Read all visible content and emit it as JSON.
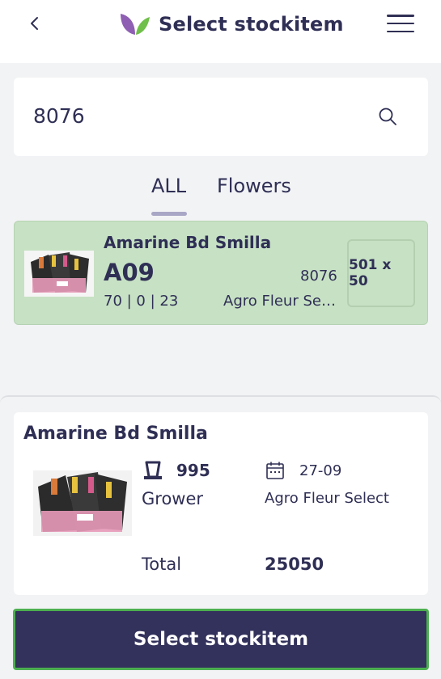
{
  "header": {
    "back_icon": "chevron-left-icon",
    "title": "Select stockitem",
    "menu_icon": "hamburger-menu-icon",
    "logo_colors": [
      "#8e5fb3",
      "#6fbf4a"
    ]
  },
  "search": {
    "value": "8076",
    "icon": "search-icon"
  },
  "tabs": [
    {
      "label": "ALL",
      "active": true
    },
    {
      "label": "Flowers",
      "active": false
    }
  ],
  "result": {
    "name": "Amarine Bd Smilla",
    "code": "A09",
    "number": "8076",
    "stock": "70 | 0 | 23",
    "supplier": "Agro Fleur Sel...",
    "size": "501 x 50",
    "background": "#c7e1c4"
  },
  "detail": {
    "name": "Amarine Bd Smilla",
    "quantity": "995",
    "date": "27-09",
    "grower_label": "Grower",
    "supplier": "Agro Fleur Select",
    "total_label": "Total",
    "total_value": "25050"
  },
  "action": {
    "button_label": "Select stockitem",
    "color": "#33325c",
    "highlight": "#4caf50"
  }
}
